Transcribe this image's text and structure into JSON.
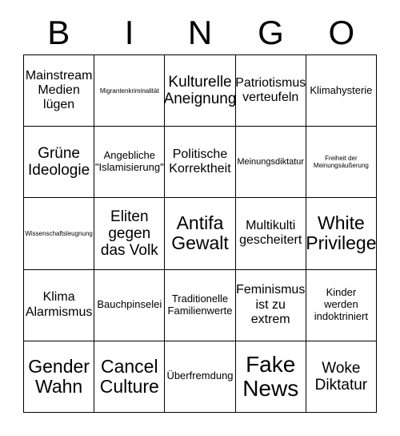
{
  "header": {
    "letters": [
      "B",
      "I",
      "N",
      "G",
      "O"
    ]
  },
  "colors": {
    "border": "#000000",
    "background": "#ffffff",
    "text": "#000000"
  },
  "grid": {
    "columns": 5,
    "rows": 5,
    "cells": [
      {
        "text": "Mainstream\nMedien\nlügen",
        "size": "lg"
      },
      {
        "text": "Migrantenkriminalität",
        "size": "xs"
      },
      {
        "text": "Kulturelle\nAneignung",
        "size": "xl"
      },
      {
        "text": "Patriotismus\nverteufeln",
        "size": "lg"
      },
      {
        "text": "Klimahysterie",
        "size": "md"
      },
      {
        "text": "Grüne\nIdeologie",
        "size": "xl"
      },
      {
        "text": "Angebliche\n\"Islamisierung\"",
        "size": "md"
      },
      {
        "text": "Politische\nKorrektheit",
        "size": "lg"
      },
      {
        "text": "Meinungsdiktatur",
        "size": "sm"
      },
      {
        "text": "Freiheit der\nMeinungsäußerung",
        "size": "xs"
      },
      {
        "text": "Wissenschaftsleugnung",
        "size": "xs"
      },
      {
        "text": "Eliten\ngegen\ndas Volk",
        "size": "xl"
      },
      {
        "text": "Antifa\nGewalt",
        "size": "xxl"
      },
      {
        "text": "Multikulti\ngescheitert",
        "size": "lg"
      },
      {
        "text": "White\nPrivilege",
        "size": "xxl"
      },
      {
        "text": "Klima\nAlarmismus",
        "size": "lg"
      },
      {
        "text": "Bauchpinselei",
        "size": "md"
      },
      {
        "text": "Traditionelle\nFamilienwerte",
        "size": "md"
      },
      {
        "text": "Feminismus\nist zu\nextrem",
        "size": "lg"
      },
      {
        "text": "Kinder\nwerden\nindoktriniert",
        "size": "md"
      },
      {
        "text": "Gender\nWahn",
        "size": "xxl"
      },
      {
        "text": "Cancel\nCulture",
        "size": "xxl"
      },
      {
        "text": "Überfremdung",
        "size": "md"
      },
      {
        "text": "Fake\nNews",
        "size": "huge"
      },
      {
        "text": "Woke\nDiktatur",
        "size": "xl"
      }
    ]
  }
}
